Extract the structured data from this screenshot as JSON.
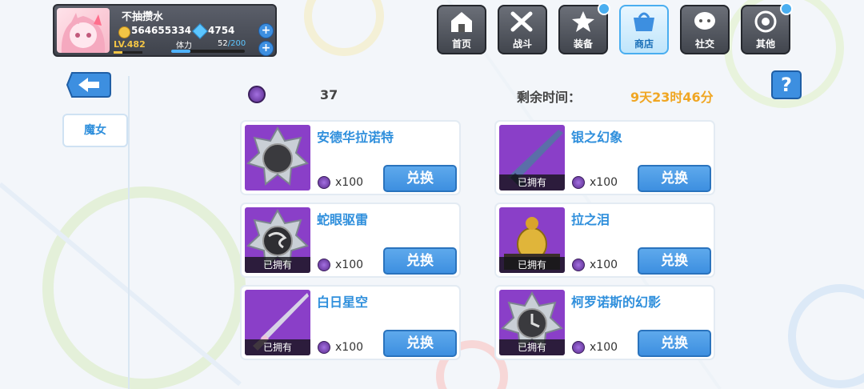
{
  "player": {
    "name": "不抽攒水",
    "coins": "564655334",
    "gems": "4754",
    "level": "LV.482",
    "stamina_label": "体力",
    "stamina_current": "52",
    "stamina_max": "/200",
    "add_symbol": "+"
  },
  "nav": [
    {
      "label": "首页",
      "icon": "house-icon",
      "badge": false
    },
    {
      "label": "战斗",
      "icon": "crossed-swords-icon",
      "badge": false
    },
    {
      "label": "装备",
      "icon": "star-gun-icon",
      "badge": true
    },
    {
      "label": "商店",
      "icon": "shop-basket-icon",
      "badge": false,
      "active": true
    },
    {
      "label": "社交",
      "icon": "chat-face-icon",
      "badge": false
    },
    {
      "label": "其他",
      "icon": "target-icon",
      "badge": true
    }
  ],
  "sidebar": {
    "tab_label": "魔女"
  },
  "shop": {
    "currency_amount": "37",
    "time_label": "剩余时间：",
    "time_remaining": "9天23时46分",
    "help_label": "?",
    "exchange_label": "兑换",
    "owned_label": "已拥有",
    "items": [
      {
        "name": "安德华拉诺特",
        "price": "x100",
        "owned": false
      },
      {
        "name": "银之幻象",
        "price": "x100",
        "owned": true
      },
      {
        "name": "蛇眼驱雷",
        "price": "x100",
        "owned": true
      },
      {
        "name": "拉之泪",
        "price": "x100",
        "owned": true
      },
      {
        "name": "白日星空",
        "price": "x100",
        "owned": true
      },
      {
        "name": "柯罗诺斯的幻影",
        "price": "x100",
        "owned": true
      }
    ]
  },
  "colors": {
    "accent_blue": "#3d8fe0",
    "item_name": "#2f8fdc",
    "timer": "#f0a623",
    "purple": "#8a3fc8"
  }
}
